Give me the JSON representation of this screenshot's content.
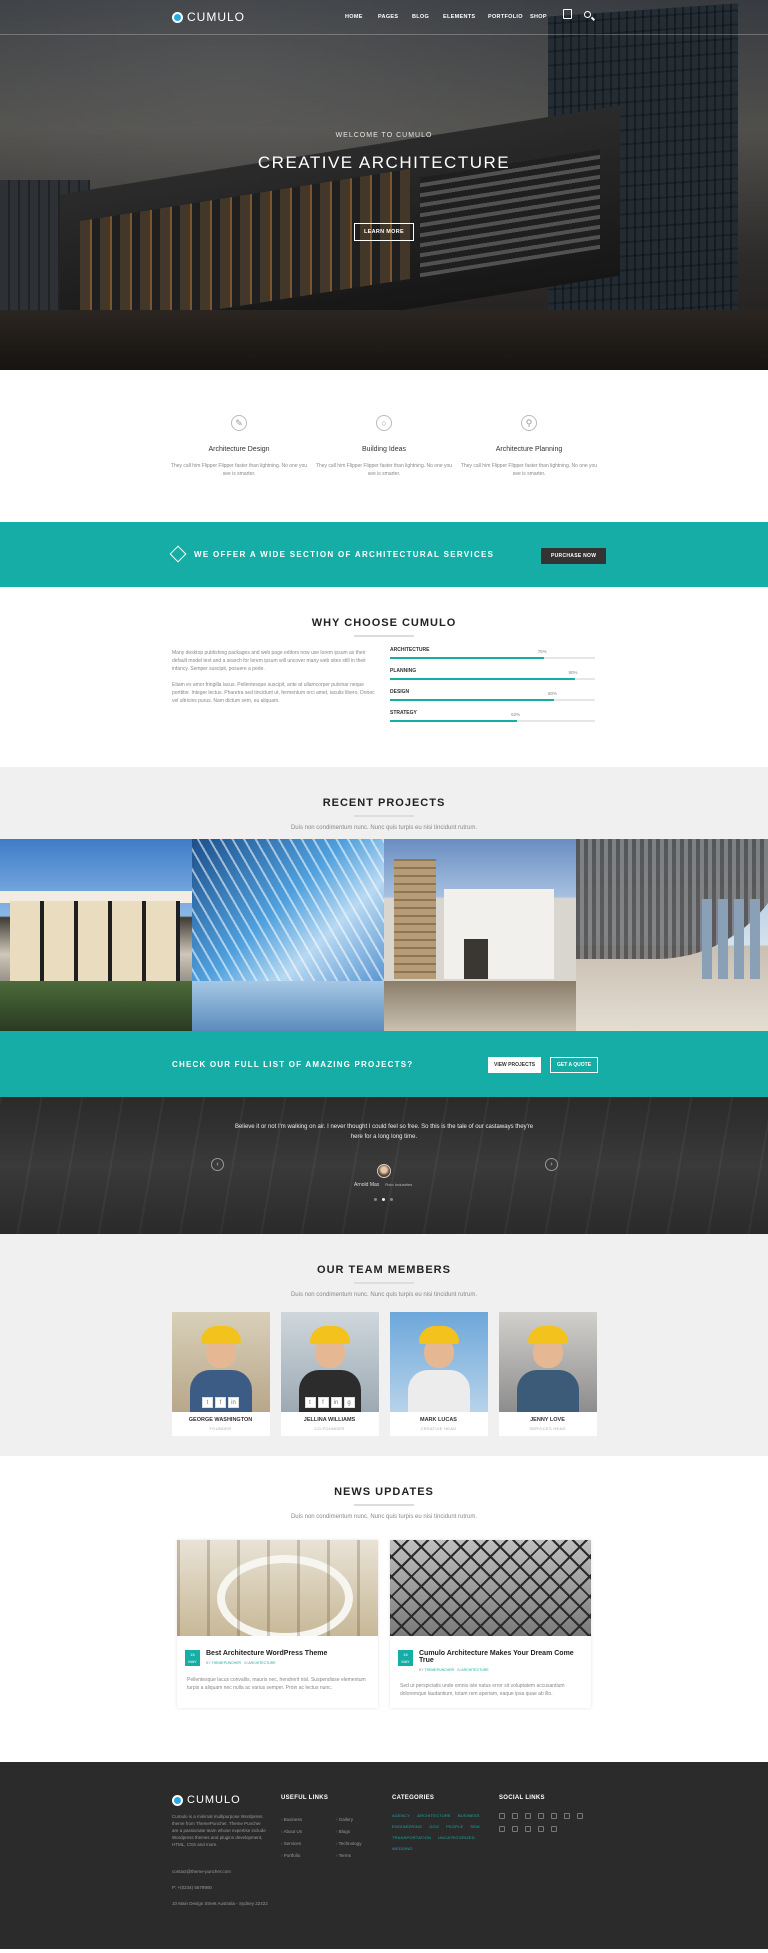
{
  "nav": {
    "logo": "CUMULO",
    "menu": [
      "HOME",
      "PAGES",
      "BLOG",
      "ELEMENTS",
      "PORTFOLIO",
      "SHOP"
    ]
  },
  "hero": {
    "welcome": "WELCOME TO CUMULO",
    "title": "CREATIVE ARCHITECTURE",
    "button": "LEARN MORE"
  },
  "features": [
    {
      "icon": "drafting-tools-icon",
      "title": "Architecture Design",
      "text": "They call him Flipper Flipper faster than lightning. No one you see is smarter."
    },
    {
      "icon": "lightbulb-icon",
      "title": "Building Ideas",
      "text": "They call him Flipper Flipper faster than lightning. No one you see is smarter."
    },
    {
      "icon": "compass-icon",
      "title": "Architecture Planning",
      "text": "They call him Flipper Flipper faster than lightning. No one you see is smarter."
    }
  ],
  "cta": {
    "text": "WE OFFER A WIDE SECTION OF ARCHITECTURAL SERVICES",
    "button": "PURCHASE NOW"
  },
  "why": {
    "title": "WHY CHOOSE CUMULO",
    "p1": "Many desktop publishing packages and web page editors now use lorem ipsum as their default model text and a search for lorem ipsum will uncover many web sites still in their infancy. Semper suscipit, posuere a pede.",
    "p2": "Etiam ex amor fringilla lacus. Pellentesque suscipit, ante at ullamcorper pulvinar neque porttitor. Integer lectus. Pharetra sed tincidunt ut, fermentum orci amet, iaculis libero. Donec vel ultricies purus. Nam dictum sem, eu aliquam.",
    "skills": [
      {
        "label": "ARCHITECTURE",
        "value": 75,
        "text": "75%"
      },
      {
        "label": "PLANNING",
        "value": 90,
        "text": "90%"
      },
      {
        "label": "DESIGN",
        "value": 80,
        "text": "80%"
      },
      {
        "label": "STRATEGY",
        "value": 62,
        "text": "62%"
      }
    ]
  },
  "projects": {
    "title": "RECENT PROJECTS",
    "subtitle": "Duis non condimentum nunc. Nunc quis turpis eu nisi tincidunt rutrum.",
    "cta_text": "CHECK OUR FULL LIST OF AMAZING PROJECTS?",
    "btn_view": "VIEW PROJECTS",
    "btn_quote": "GET A QUOTE"
  },
  "testimonial": {
    "quote": "Believe it or not I'm walking on air. I never thought I could feel so free. So this is the tale of our castaways they're here for a long long time.",
    "name": "Arnold Max",
    "role": "Roto Industries"
  },
  "team": {
    "title": "OUR TEAM MEMBERS",
    "subtitle": "Duis non condimentum nunc. Nunc quis turpis eu nisi tincidunt rutrum.",
    "members": [
      {
        "name": "GEORGE WASHINGTON",
        "role": "FOUNDER"
      },
      {
        "name": "JELLINA WILLIAMS",
        "role": "CO-FOUNDER"
      },
      {
        "name": "MARK LUCAS",
        "role": "CREATIVE HEAD"
      },
      {
        "name": "JENNY LOVE",
        "role": "SERVICES HEAD"
      }
    ]
  },
  "news": {
    "title": "NEWS UPDATES",
    "subtitle": "Duis non condimentum nunc. Nunc quis turpis eu nisi tincidunt rutrum.",
    "posts": [
      {
        "day": "16",
        "month": "MAY",
        "title": "Best Architecture WordPress Theme",
        "author": "THEMEPUNCHER",
        "category": "ARCHITECTURE",
        "excerpt": "Pellentesque lacus convallis, mauris nec, hendrerit nisl. Suspendisse elementum turpis a aliquam nec nulla ac varius semper. Proin ac lectus nunc."
      },
      {
        "day": "16",
        "month": "MAY",
        "title": "Cumulo Architecture Makes Your Dream Come True",
        "author": "THEMEPUNCHER",
        "category": "ARCHITECTURE",
        "excerpt": "Sed ut perspiciatis unde omnis iste natus error sit voluptatem accusantium doloremque laudantium, totam rem aperiam, eaque ipsa quae ab illo."
      }
    ]
  },
  "footer": {
    "logo": "CUMULO",
    "about": "Cumulo is a minimal multipurpose Wordpress theme from ThemePuncher. Theme Puncher are a passionate team whose expertise include Wordpress themes and plugins development, HTML, CSS and more.",
    "email": "contact@theme-puncher.com",
    "phone": "P: +(0234) 5678900",
    "address": "10 Main Design Street Australia - Sydney 22422",
    "useful_links_title": "USEFUL LINKS",
    "links_col1": [
      "Business",
      "About Us",
      "Services",
      "Portfolio"
    ],
    "links_col2": [
      "Gallery",
      "Blogs",
      "Technology",
      "Terms"
    ],
    "categories_title": "CATEGORIES",
    "categories": [
      "AGENCY",
      "ARCHITECTURE",
      "BUSINESS",
      "ENGINEERING",
      "GGG",
      "PEOPLE",
      "SEM",
      "TRANSPORTATION",
      "UNCATEGORIZED",
      "WEDDING"
    ],
    "social_title": "SOCIAL LINKS"
  },
  "colors": {
    "accent": "#15ada5",
    "dark": "#2b2b2b",
    "light_bg": "#f0f0f0"
  }
}
